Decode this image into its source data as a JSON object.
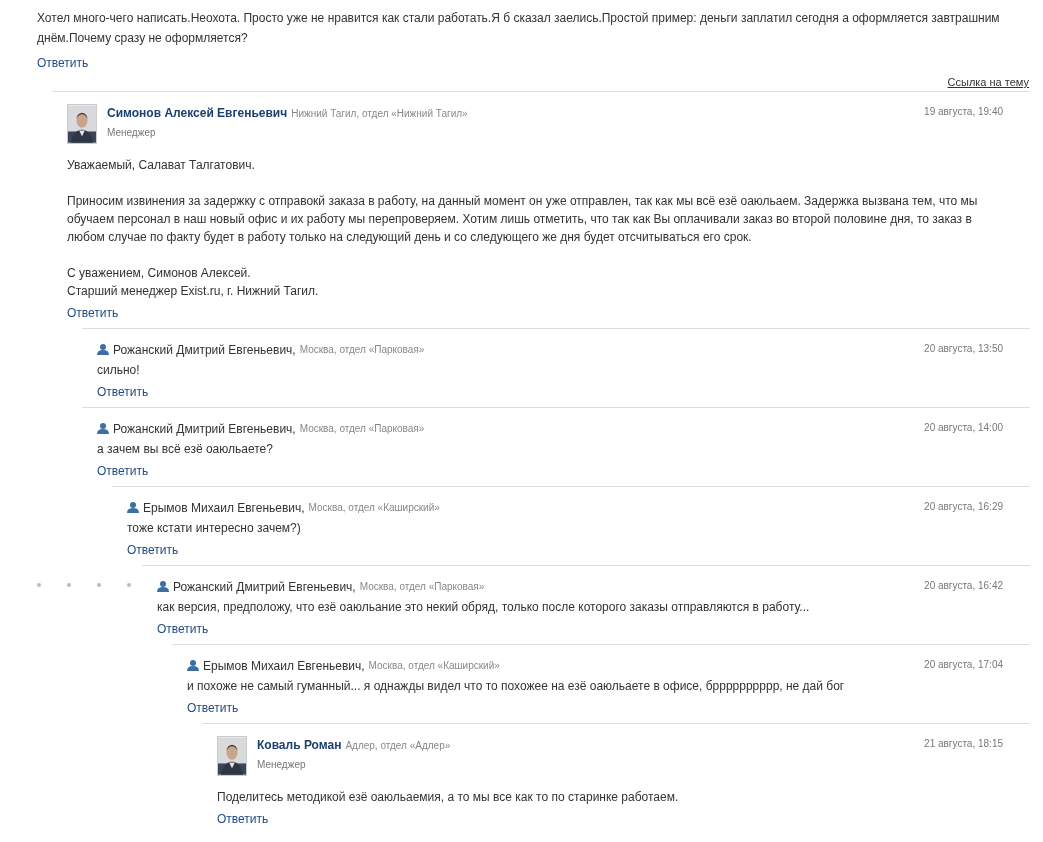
{
  "top_comment": {
    "text": "Хотел много-чего написать.Неохота. Просто уже не нравится как стали работать.Я б сказал заелись.Простой пример: деньги заплатил сегодня а оформляется завтрашним днём.Почему сразу не оформляется?",
    "reply": "Ответить"
  },
  "topic_link": "Ссылка на тему",
  "comments": [
    {
      "kind": "manager",
      "author": "Симонов Алексей Евгеньевич",
      "location": "Нижний Тагил, отдел «Нижний Тагил»",
      "role": "Менеджер",
      "date": "19 августа, 19:40",
      "paragraphs": [
        "Уважаемый, Салават Талгатович.",
        "Приносим извинения за задержку с отправокй заказа в работу, на данный момент он уже отправлен, так как мы всё езё оаюльаем. Задержка вызвана тем, что мы обучаем персонал в наш новый офис и их работу мы перепроверяем.  Хотим лишь отметить, что так как Вы оплачивали заказ во второй половине дня, то заказ в любом случае по факту будет в работу только на следующий день и со следующего же дня будет отсчитываться его срок.",
        "С уважением, Симонов Алексей.\nСтарший менеджер Exist.ru, г. Нижний Тагил."
      ],
      "reply": "Ответить",
      "children": [
        {
          "kind": "user",
          "author": "Рожанский Дмитрий Евгеньевич,",
          "location": "Москва, отдел «Парковая»",
          "date": "20 августа, 13:50",
          "paragraphs": [
            "сильно!"
          ],
          "reply": "Ответить"
        },
        {
          "kind": "user",
          "author": "Рожанский Дмитрий Евгеньевич,",
          "location": "Москва, отдел «Парковая»",
          "date": "20 августа, 14:00",
          "paragraphs": [
            "а зачем вы всё езё оаюльаете?"
          ],
          "reply": "Ответить",
          "children": [
            {
              "kind": "user",
              "author": "Ерымов Михаил Евгеньевич,",
              "location": "Москва, отдел «Каширский»",
              "date": "20 августа, 16:29",
              "paragraphs": [
                "тоже кстати интересно зачем?)"
              ],
              "reply": "Ответить",
              "children": [
                {
                  "kind": "user",
                  "author": "Рожанский Дмитрий Евгеньевич,",
                  "location": "Москва, отдел «Парковая»",
                  "date": "20 августа, 16:42",
                  "paragraphs": [
                    "как версия, предположу, что езё оаюльание это некий обряд, только после которого заказы отправляются в работу..."
                  ],
                  "reply": "Ответить",
                  "depth_dots": true,
                  "children": [
                    {
                      "kind": "user",
                      "author": "Ерымов Михаил Евгеньевич,",
                      "location": "Москва, отдел «Каширский»",
                      "date": "20 августа, 17:04",
                      "paragraphs": [
                        "и похоже не самый гуманный... я однажды видел что то похожее на езё оаюльаете в офисе, брррррррррр, не дай бог"
                      ],
                      "reply": "Ответить",
                      "children": [
                        {
                          "kind": "manager",
                          "author": "Коваль Роман",
                          "location": "Адлер, отдел «Адлер»",
                          "role": "Менеджер",
                          "date": "21 августа, 18:15",
                          "paragraphs": [
                            "Поделитесь методикой езё оаюльаемия, а то мы все как то по старинке работаем."
                          ],
                          "reply": "Ответить"
                        }
                      ]
                    }
                  ]
                }
              ]
            }
          ]
        }
      ]
    }
  ]
}
